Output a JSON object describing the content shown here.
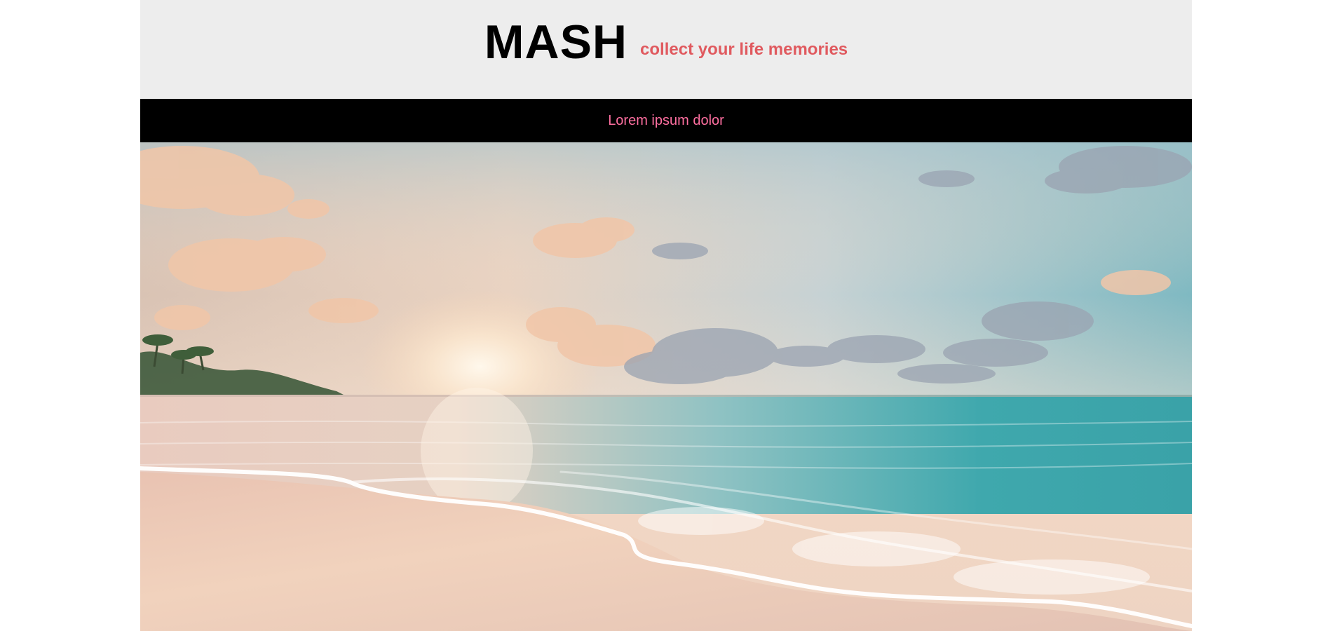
{
  "header": {
    "brand": "MASH",
    "tagline": "collect your life memories"
  },
  "nav": {
    "link_label": "Lorem ipsum dolor"
  },
  "hero": {
    "image_subject": "beach-sunset-photo"
  },
  "colors": {
    "header_bg": "#ededed",
    "tagline": "#e05a5f",
    "nav_bg": "#000000",
    "nav_link": "#ff6fa0"
  }
}
